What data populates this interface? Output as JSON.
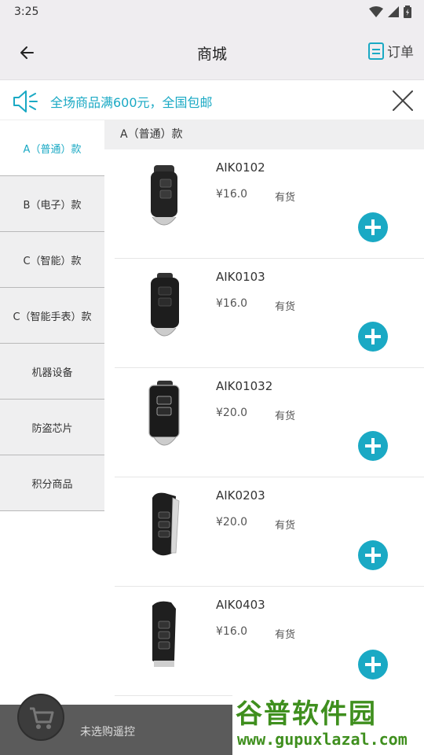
{
  "status_bar": {
    "time": "3:25"
  },
  "app_bar": {
    "title": "商城",
    "orders_label": "订单"
  },
  "notice": {
    "text": "全场商品满600元，全国包邮"
  },
  "sidebar": {
    "categories": [
      {
        "label": "A（普通）款",
        "active": true
      },
      {
        "label": "B（电子）款"
      },
      {
        "label": "C（智能）款"
      },
      {
        "label": "C（智能手表）款"
      },
      {
        "label": "机器设备"
      },
      {
        "label": "防盗芯片"
      },
      {
        "label": "积分商品"
      }
    ]
  },
  "content": {
    "section_title": "A（普通）款",
    "products": [
      {
        "code": "AIK0102",
        "price": "¥16.0",
        "stock": "有货"
      },
      {
        "code": "AIK0103",
        "price": "¥16.0",
        "stock": "有货"
      },
      {
        "code": "AIK01032",
        "price": "¥20.0",
        "stock": "有货"
      },
      {
        "code": "AIK0203",
        "price": "¥20.0",
        "stock": "有货"
      },
      {
        "code": "AIK0403",
        "price": "¥16.0",
        "stock": "有货"
      }
    ]
  },
  "bottom_bar": {
    "cart_text": "未选购遥控"
  },
  "watermark": {
    "top": "谷普软件园",
    "bottom": "www.gupuxlazal.com"
  },
  "colors": {
    "accent": "#1aa9c4",
    "appbar_bg": "#efedf0",
    "bottom_bar_bg": "#5b5b5b"
  },
  "icons": [
    "wifi-icon",
    "signal-icon",
    "battery-icon",
    "back-arrow-icon",
    "order-icon",
    "speaker-icon",
    "close-icon",
    "add-icon",
    "cart-icon"
  ]
}
